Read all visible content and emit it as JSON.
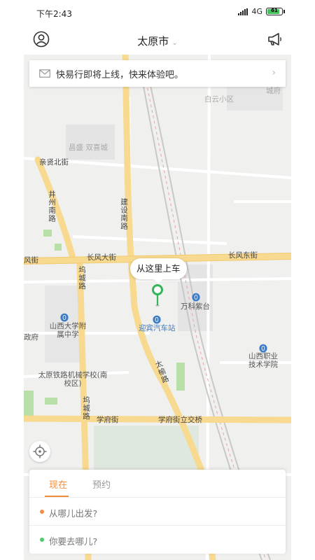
{
  "status_bar": {
    "time": "下午2:43",
    "network": "4G",
    "battery": "61"
  },
  "header": {
    "city": "太原市"
  },
  "notice": {
    "text": "快易行即将上线，快来体验吧。"
  },
  "map": {
    "pickup_label": "从这里上车",
    "labels": {
      "baiyun": "白云小区",
      "changsheng": "昌盛 双喜城",
      "qinxian": "亲贤北街",
      "jingzhou": "井州南路",
      "jianshe": "建设南路",
      "changfeng_da": "长风大街",
      "changfeng_dong": "长风东街",
      "fengjie_left": "风街",
      "wucheng1": "坞城路",
      "wucheng2": "坞城路",
      "shanxi_univ": "山西大学附属中学",
      "zhengfu": "政府",
      "vanke": "万科紫台",
      "yingbin": "迎宾汽车站",
      "taiyu": "太榆路",
      "vocational": "山西职业技术学院",
      "railway_school": "太原铁路机械学校(南校区)",
      "xuefu": "学府街",
      "xuefu_bridge": "学府街立交桥",
      "chengfu": "城府"
    }
  },
  "tabs": {
    "now": "现在",
    "reserve": "预约"
  },
  "booking": {
    "from_placeholder": "从哪儿出发?",
    "to_placeholder": "你要去哪儿?"
  },
  "icons": {
    "user": "user-circle-icon",
    "speaker": "megaphone-icon",
    "mail": "mail-icon",
    "pin": "location-pin-icon",
    "locate": "crosshair-icon"
  },
  "colors": {
    "accent": "#f08b3a",
    "start_dot": "#f28c48",
    "end_dot": "#4ccb6b",
    "pin": "#35b55a",
    "road_major": "#f7d98f"
  }
}
